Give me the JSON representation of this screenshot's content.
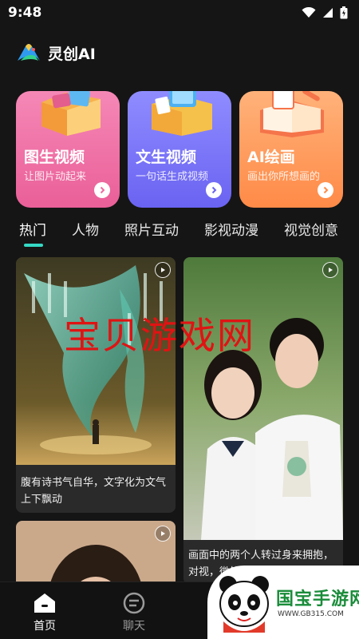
{
  "status_bar": {
    "time": "9:48"
  },
  "app": {
    "title": "灵创AI"
  },
  "cards": [
    {
      "title": "图生视频",
      "subtitle": "让图片动起来",
      "color": "#ee6aa1"
    },
    {
      "title": "文生视频",
      "subtitle": "一句话生成视频",
      "color": "#7b76f8"
    },
    {
      "title": "AI绘画",
      "subtitle": "画出你所想画的",
      "color": "#ff9a5a"
    }
  ],
  "tabs": [
    {
      "label": "热门",
      "active": true
    },
    {
      "label": "人物"
    },
    {
      "label": "照片互动"
    },
    {
      "label": "影视动漫"
    },
    {
      "label": "视觉创意"
    }
  ],
  "tiles": [
    {
      "caption": "腹有诗书气自华，文字化为文气上下飘动"
    },
    {
      "caption": "画面中的两个人转过身来拥抱，对视，微笑"
    },
    {
      "caption": ""
    }
  ],
  "watermark": {
    "text": "宝贝游戏网"
  },
  "bottom_nav": {
    "home_label": "首页",
    "chat_label": "聊天"
  },
  "site_badge": {
    "name": "国宝手游网",
    "url": "WWW.GB315.COM"
  },
  "colors": {
    "accent": "#35d9c5",
    "background": "#151515"
  }
}
